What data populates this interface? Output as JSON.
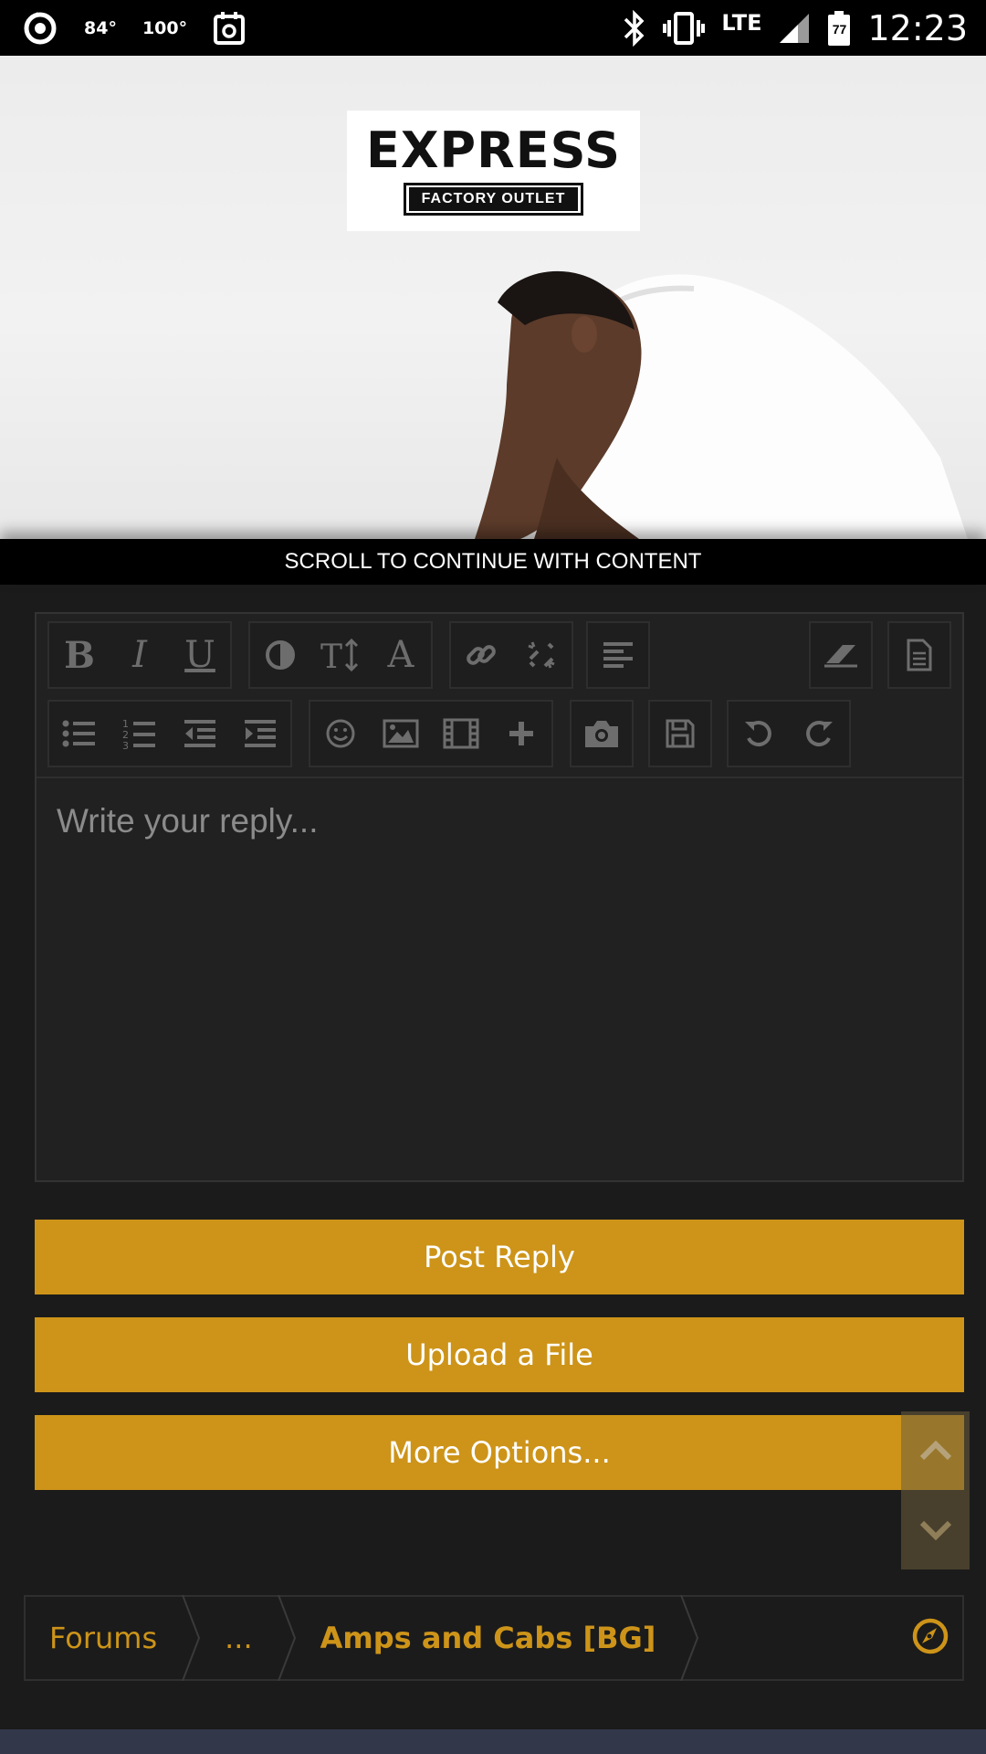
{
  "status_bar": {
    "temp1": "84°",
    "temp2": "100°",
    "network": "LTE",
    "battery_level": "77",
    "time": "12:23"
  },
  "ad": {
    "brand": "EXPRESS",
    "sub_brand": "FACTORY OUTLET",
    "scroll_notice": "SCROLL TO CONTINUE WITH CONTENT"
  },
  "editor": {
    "placeholder": "Write your reply..."
  },
  "buttons": {
    "post_reply": "Post Reply",
    "upload_file": "Upload a File",
    "more_options": "More Options..."
  },
  "breadcrumb": {
    "items": [
      "Forums",
      "...",
      "Amps and Cabs [BG]"
    ]
  },
  "colors": {
    "accent": "#cd9419",
    "background": "#1b1b1b",
    "editor_bg": "#212121",
    "footer_strip": "#33374a"
  }
}
